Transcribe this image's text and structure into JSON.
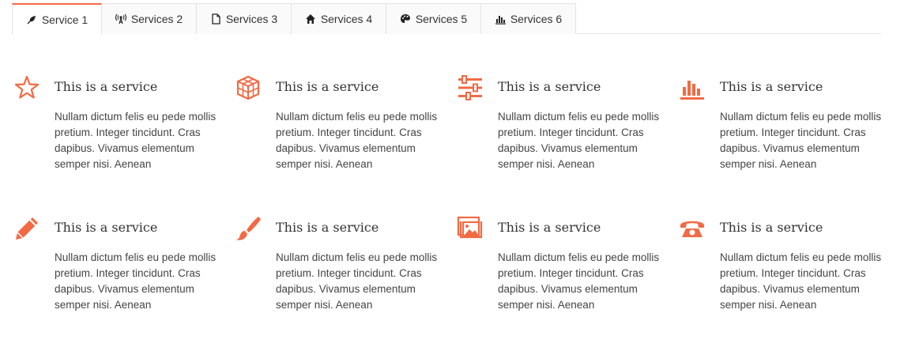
{
  "accent": "#f26a44",
  "tabs": [
    {
      "label": "Service 1",
      "icon": "leaf-pen-icon",
      "active": true
    },
    {
      "label": "Services 2",
      "icon": "broadcast-icon",
      "active": false
    },
    {
      "label": "Services 3",
      "icon": "document-icon",
      "active": false
    },
    {
      "label": "Services 4",
      "icon": "home-icon",
      "active": false
    },
    {
      "label": "Services 5",
      "icon": "palette-icon",
      "active": false
    },
    {
      "label": "Services 6",
      "icon": "bar-chart-icon",
      "active": false
    }
  ],
  "services": [
    {
      "icon": "star-icon",
      "title": "This is a service",
      "desc": "Nullam dictum felis eu pede mollis pretium. Integer tincidunt. Cras dapibus. Vivamus elementum semper nisi. Aenean"
    },
    {
      "icon": "cube-icon",
      "title": "This is a service",
      "desc": "Nullam dictum felis eu pede mollis pretium. Integer tincidunt. Cras dapibus. Vivamus elementum semper nisi. Aenean"
    },
    {
      "icon": "sliders-icon",
      "title": "This is a service",
      "desc": "Nullam dictum felis eu pede mollis pretium. Integer tincidunt. Cras dapibus. Vivamus elementum semper nisi. Aenean"
    },
    {
      "icon": "bar-chart-icon",
      "title": "This is a service",
      "desc": "Nullam dictum felis eu pede mollis pretium. Integer tincidunt. Cras dapibus. Vivamus elementum semper nisi. Aenean"
    },
    {
      "icon": "pencil-icon",
      "title": "This is a service",
      "desc": "Nullam dictum felis eu pede mollis pretium. Integer tincidunt. Cras dapibus. Vivamus elementum semper nisi. Aenean"
    },
    {
      "icon": "brush-icon",
      "title": "This is a service",
      "desc": "Nullam dictum felis eu pede mollis pretium. Integer tincidunt. Cras dapibus. Vivamus elementum semper nisi. Aenean"
    },
    {
      "icon": "image-icon",
      "title": "This is a service",
      "desc": "Nullam dictum felis eu pede mollis pretium. Integer tincidunt. Cras dapibus. Vivamus elementum semper nisi. Aenean"
    },
    {
      "icon": "phone-icon",
      "title": "This is a service",
      "desc": "Nullam dictum felis eu pede mollis pretium. Integer tincidunt. Cras dapibus. Vivamus elementum semper nisi. Aenean"
    }
  ]
}
